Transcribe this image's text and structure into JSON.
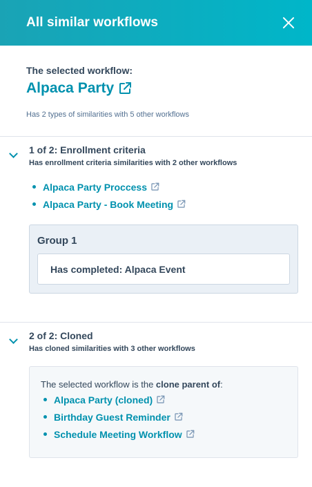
{
  "header": {
    "title": "All similar workflows",
    "close_icon": "close-icon"
  },
  "selected": {
    "label": "The selected workflow:",
    "name": "Alpaca Party",
    "summary": "Has 2 types of similarities with 5 other workflows"
  },
  "sections": [
    {
      "title": "1 of 2: Enrollment criteria",
      "subtitle": "Has enrollment criteria similarities with 2 other workflows",
      "workflows": [
        "Alpaca Party Proccess",
        "Alpaca Party - Book Meeting"
      ],
      "group": {
        "title": "Group 1",
        "filter": "Has completed: Alpaca Event"
      }
    },
    {
      "title": "2 of 2: Cloned",
      "subtitle": "Has cloned similarities with 3 other workflows",
      "intro_prefix": "The selected workflow is the ",
      "intro_bold": "clone parent of",
      "intro_suffix": ":",
      "workflows": [
        "Alpaca Party (cloned)",
        "Birthday Guest Reminder",
        "Schedule Meeting Workflow"
      ]
    }
  ],
  "colors": {
    "header_bg": "#00b6c9",
    "link": "#0091ae",
    "text": "#33475b"
  }
}
